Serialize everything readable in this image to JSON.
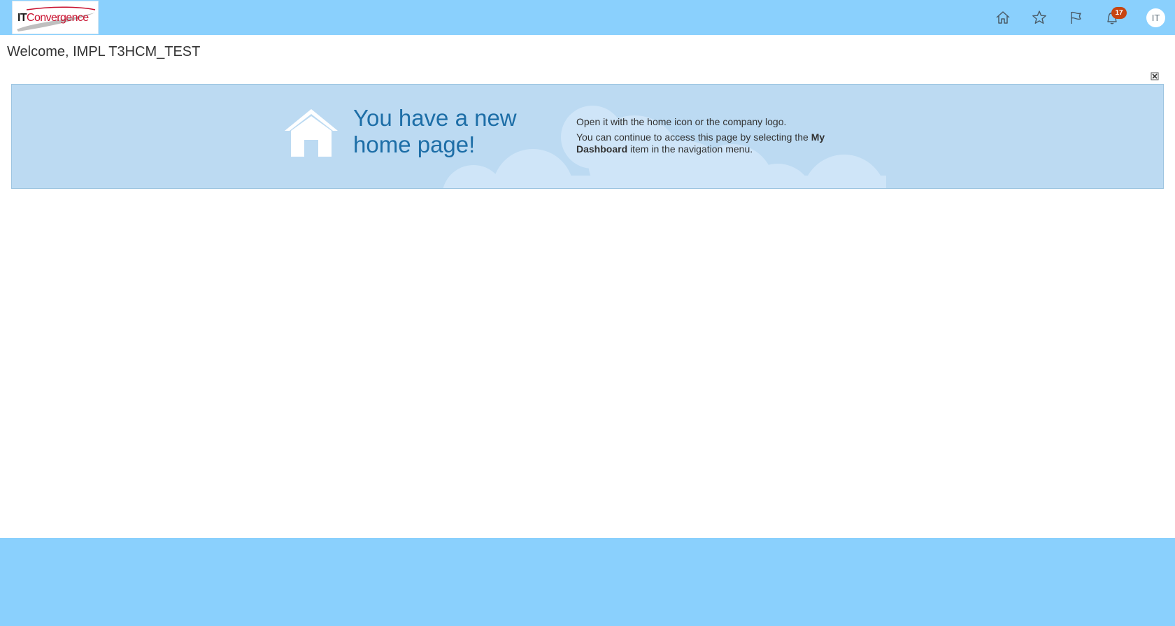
{
  "header": {
    "logo": {
      "it": "IT",
      "convergence": "Convergence"
    },
    "icons": [
      "home-icon",
      "star-icon",
      "flag-icon",
      "notification-icon"
    ],
    "notification_count": "17",
    "avatar_initials": "IT"
  },
  "welcome": "Welcome, IMPL T3HCM_TEST",
  "banner": {
    "headline_line1": "You have a new",
    "headline_line2": "home page!",
    "line1": "Open it with the home icon or the company logo.",
    "line2_prefix": "You can continue to access this page by selecting the ",
    "line2_bold": "My Dashboard",
    "line2_suffix": " item in the navigation menu."
  },
  "colors": {
    "bar": "#8ad0fd",
    "banner": "#bcdaf2",
    "headline": "#1d6ea7",
    "badge": "#c74512",
    "logo_red": "#c8102e"
  }
}
